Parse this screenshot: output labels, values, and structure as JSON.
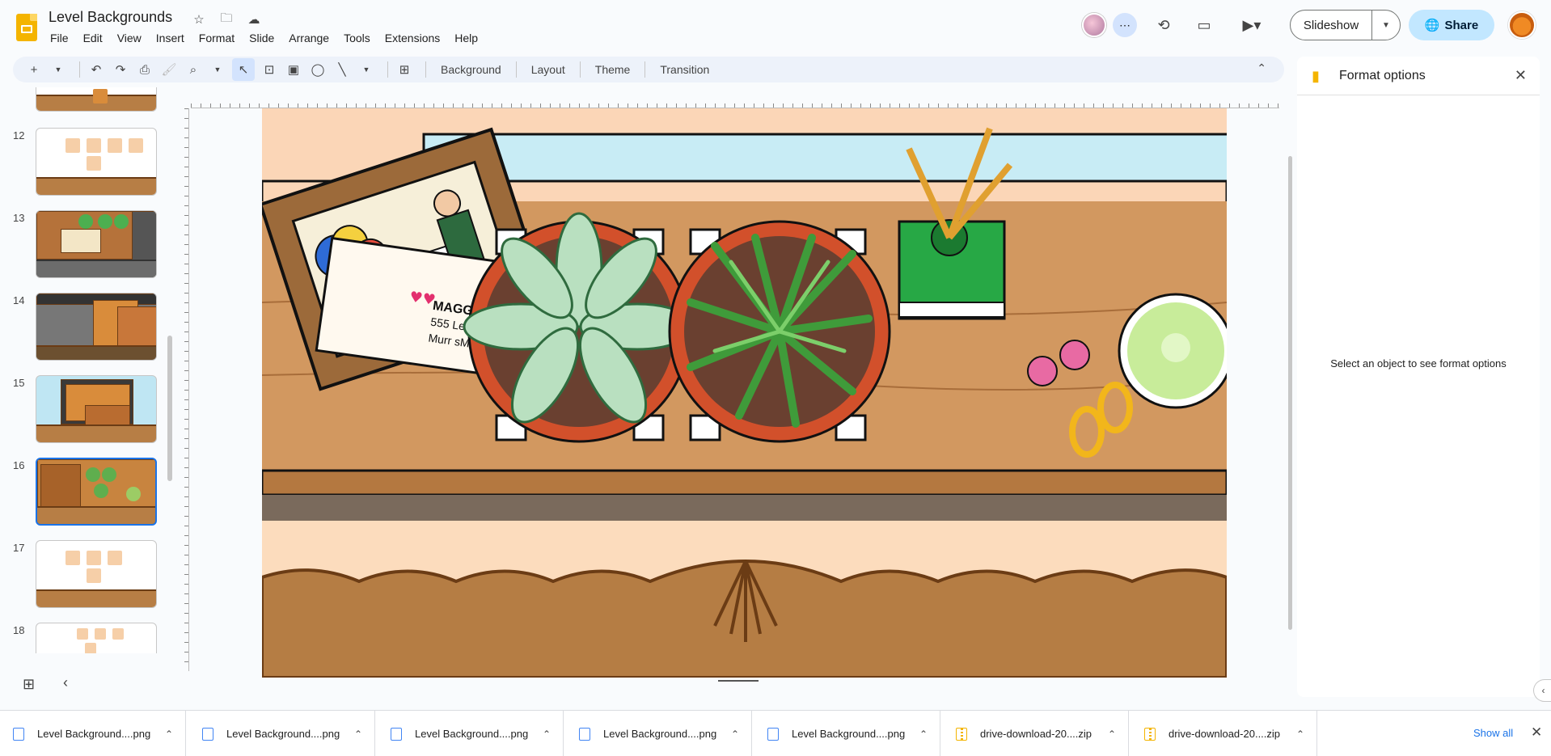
{
  "app": {
    "doc_title": "Level Backgrounds",
    "menu": [
      "File",
      "Edit",
      "View",
      "Insert",
      "Format",
      "Slide",
      "Arrange",
      "Tools",
      "Extensions",
      "Help"
    ],
    "slideshow_label": "Slideshow",
    "share_label": "Share"
  },
  "toolbar": {
    "background": "Background",
    "layout": "Layout",
    "theme": "Theme",
    "transition": "Transition"
  },
  "filmstrip": {
    "slides": [
      {
        "num": "12"
      },
      {
        "num": "13"
      },
      {
        "num": "14"
      },
      {
        "num": "15"
      },
      {
        "num": "16"
      },
      {
        "num": "17"
      },
      {
        "num": "18"
      }
    ]
  },
  "slide_art": {
    "envelope_line1": "MAGGIE GREE",
    "envelope_line2": "555 Lemon Dr",
    "envelope_line3": "Murr sMITH"
  },
  "panel": {
    "title": "Format options",
    "message": "Select an object to see format options"
  },
  "downloads": {
    "items": [
      {
        "name": "Level Background....png",
        "type": "png"
      },
      {
        "name": "Level Background....png",
        "type": "png"
      },
      {
        "name": "Level Background....png",
        "type": "png"
      },
      {
        "name": "Level Background....png",
        "type": "png"
      },
      {
        "name": "Level Background....png",
        "type": "png"
      },
      {
        "name": "drive-download-20....zip",
        "type": "zip"
      },
      {
        "name": "drive-download-20....zip",
        "type": "zip"
      }
    ],
    "show_all": "Show all"
  },
  "colors": {
    "accent": "#c2e7ff",
    "brand": "#f4b400",
    "link": "#1a73e8"
  }
}
